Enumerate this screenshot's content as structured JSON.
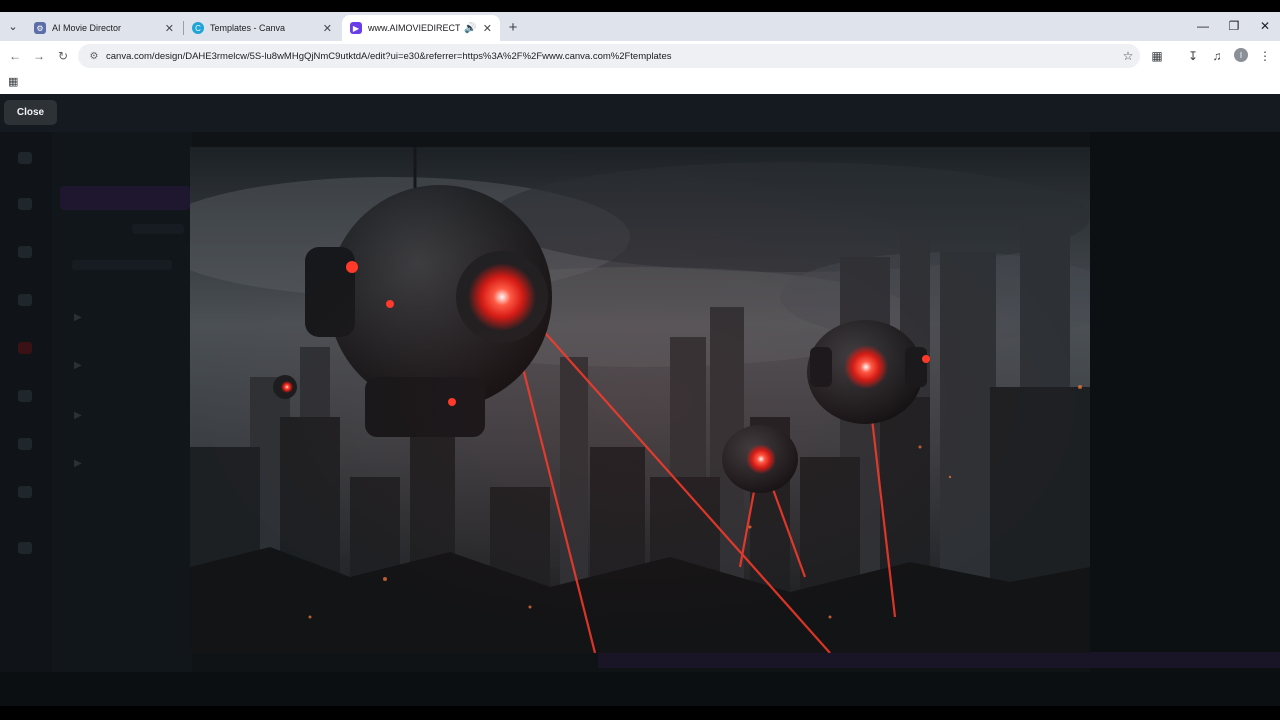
{
  "tabs": [
    {
      "title": "AI Movie Director",
      "favicon": "gear-icon",
      "active": false
    },
    {
      "title": "Templates - Canva",
      "favicon": "canva-icon",
      "active": false
    },
    {
      "title": "www.AIMOVIEDIRECTOR.co",
      "favicon": "video-icon",
      "active": true,
      "audio": true
    }
  ],
  "address_bar": {
    "url": "canva.com/design/DAHE3rmelcw/5S-lu8wMHgQjNmC9utktdA/edit?ui=e30&referrer=https%3A%2F%2Fwww.canva.com%2Ftemplates"
  },
  "player": {
    "close_label": "Close",
    "video_description": "Dark dystopian city skyline with spherical robotic drones firing red lasers"
  },
  "colors": {
    "accent_red": "#ff2a1f",
    "tab_strip": "#dfe3eb",
    "overlay_bg": "#0f1316"
  }
}
